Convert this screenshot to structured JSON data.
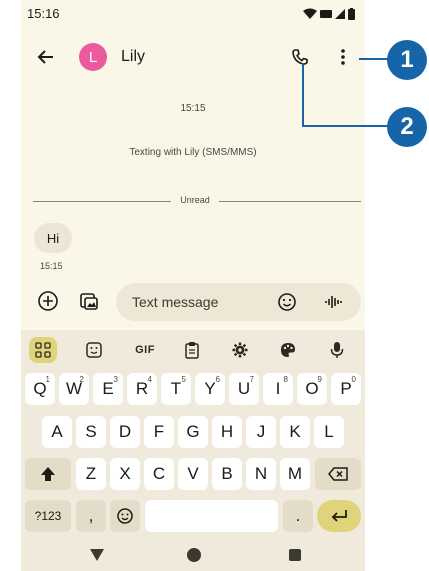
{
  "status_bar": {
    "time": "15:16"
  },
  "header": {
    "contact_initial": "L",
    "contact_name": "Lily"
  },
  "conversation": {
    "top_timestamp": "15:15",
    "info_text": "Texting with Lily (SMS/MMS)",
    "unread_label": "Unread",
    "messages": [
      {
        "text": "Hi",
        "time": "15:15"
      }
    ]
  },
  "compose": {
    "placeholder": "Text message"
  },
  "keyboard": {
    "toolbar": {
      "gif_label": "GIF"
    },
    "row1": [
      {
        "k": "Q",
        "hint": "1"
      },
      {
        "k": "W",
        "hint": "2"
      },
      {
        "k": "E",
        "hint": "3"
      },
      {
        "k": "R",
        "hint": "4"
      },
      {
        "k": "T",
        "hint": "5"
      },
      {
        "k": "Y",
        "hint": "6"
      },
      {
        "k": "U",
        "hint": "7"
      },
      {
        "k": "I",
        "hint": "8"
      },
      {
        "k": "O",
        "hint": "9"
      },
      {
        "k": "P",
        "hint": "0"
      }
    ],
    "row2": [
      "A",
      "S",
      "D",
      "F",
      "G",
      "H",
      "J",
      "K",
      "L"
    ],
    "row3": [
      "Z",
      "X",
      "C",
      "V",
      "B",
      "N",
      "M"
    ],
    "symbols_label": "?123",
    "comma_label": ",",
    "period_label": "."
  },
  "callouts": {
    "one": "1",
    "two": "2"
  },
  "colors": {
    "accent": "#1565a8",
    "avatar": "#ea5a9d",
    "enter_key": "#dfd47a"
  }
}
